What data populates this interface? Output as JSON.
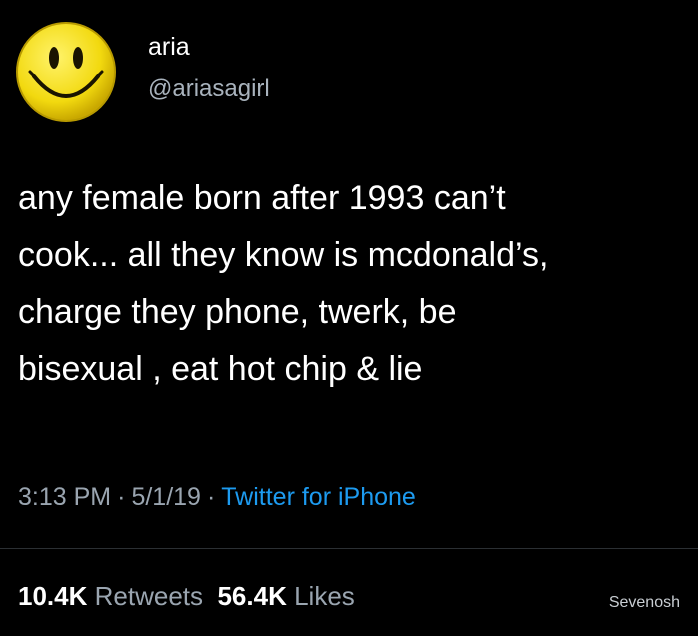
{
  "user": {
    "display_name": "aria",
    "handle": "@ariasagirl",
    "avatar_icon": "smiley-face-icon"
  },
  "tweet": {
    "text": "any female born after 1993 can’t\ncook... all they know is mcdonald’s,\ncharge they phone, twerk, be\nbisexual , eat hot chip & lie",
    "time": "3:13 PM",
    "date": "5/1/19",
    "separator": "·",
    "source": "Twitter for iPhone"
  },
  "stats": {
    "retweets_count": "10.4K",
    "retweets_label": "Retweets",
    "likes_count": "56.4K",
    "likes_label": "Likes"
  },
  "watermark": "Sevenosh",
  "colors": {
    "background": "#000000",
    "text": "#ffffff",
    "muted": "#9aa5b0",
    "link": "#1d9bf0",
    "avatar_yellow": "#f5e11a"
  }
}
